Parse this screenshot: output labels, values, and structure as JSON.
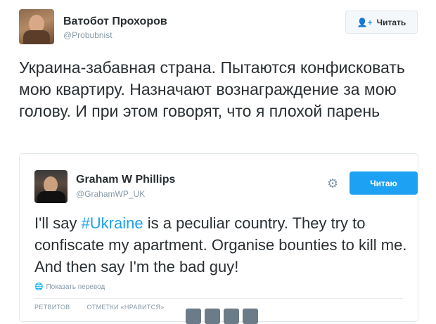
{
  "tweet": {
    "author_name": "Ватобот Прохоров",
    "author_handle": "@Probubnist",
    "follow_label": "Читать",
    "text": "Украина-забавная страна. Пытаются конфисковать мою квартиру. Назначают вознаграждение за мою голову. И при этом говорят, что я плохой парень"
  },
  "quoted": {
    "author_name": "Graham W Phillips",
    "author_handle": "@GrahamWP_UK",
    "following_label": "Читаю",
    "text_before": "I'll say ",
    "hashtag": "#Ukraine",
    "text_after": " is a peculiar country. They try to confiscate my apartment. Organise bounties to kill me. And then say I'm the bad guy!",
    "translate_label": "Показать перевод",
    "retweets_label": "РЕТВИТОВ",
    "likes_label": "ОТМЕТКИ «НРАВИТСЯ»"
  },
  "colors": {
    "accent": "#1da1f2",
    "text": "#292f33",
    "muted": "#8899a6"
  },
  "icons": {
    "follow": "follow-person-icon",
    "gear": "gear-icon",
    "translate": "globe-icon"
  }
}
